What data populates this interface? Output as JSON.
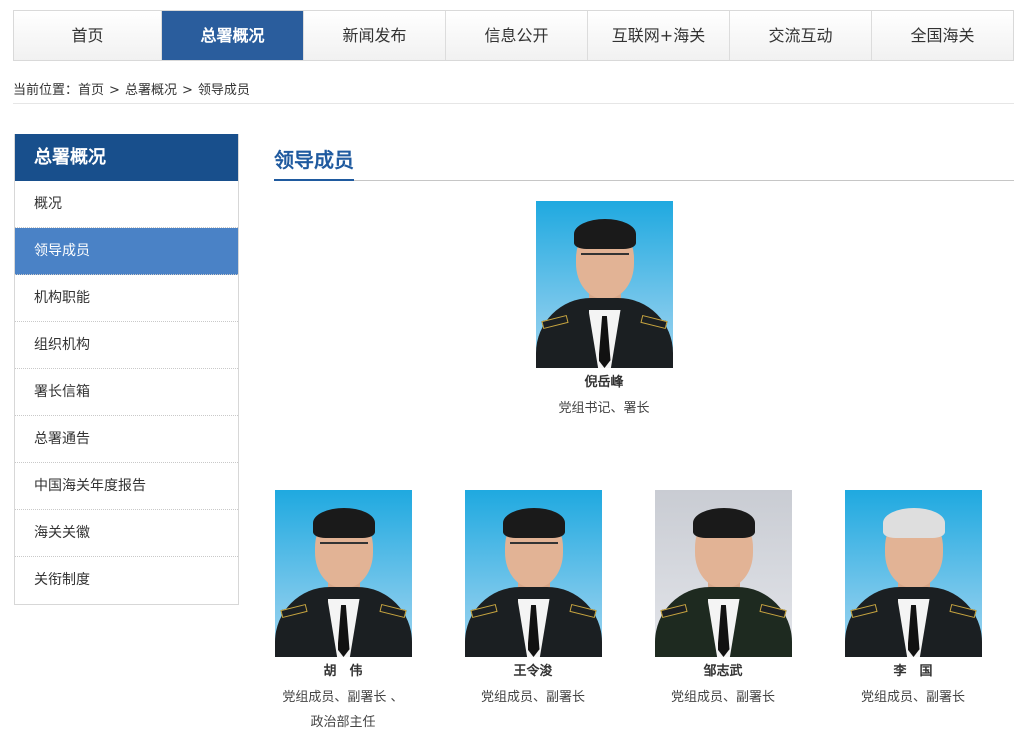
{
  "nav": {
    "items": [
      "首页",
      "总署概况",
      "新闻发布",
      "信息公开",
      "互联网+海关",
      "交流互动",
      "全国海关"
    ],
    "active_index": 1
  },
  "breadcrumb": {
    "prefix": "当前位置：",
    "items": [
      "首页",
      "总署概况",
      "领导成员"
    ],
    "separator": ">"
  },
  "sidebar": {
    "title": "总署概况",
    "items": [
      {
        "label": "概况"
      },
      {
        "label": "领导成员",
        "active": true
      },
      {
        "label": "机构职能"
      },
      {
        "label": "组织机构"
      },
      {
        "label": "署长信箱"
      },
      {
        "label": "总署通告"
      },
      {
        "label": "中国海关年度报告"
      },
      {
        "label": "海关关徽"
      },
      {
        "label": "关衔制度"
      }
    ]
  },
  "main": {
    "title": "领导成员",
    "leaders": [
      {
        "name": "倪岳峰",
        "role_lines": [
          "党组书记、署长"
        ]
      },
      {
        "name": "胡　伟",
        "role_lines": [
          "党组成员、副署长 、",
          "政治部主任"
        ]
      },
      {
        "name": "王令浚",
        "role_lines": [
          "党组成员、副署长"
        ]
      },
      {
        "name": "邹志武",
        "role_lines": [
          "党组成员、副署长"
        ]
      },
      {
        "name": "李　国",
        "role_lines": [
          "党组成员、副署长"
        ]
      }
    ]
  },
  "colors": {
    "nav_active": "#2a5d9d",
    "sidebar_title": "#184f8c",
    "sidebar_active": "#4a82c6",
    "section_title": "#1f5a9f"
  }
}
